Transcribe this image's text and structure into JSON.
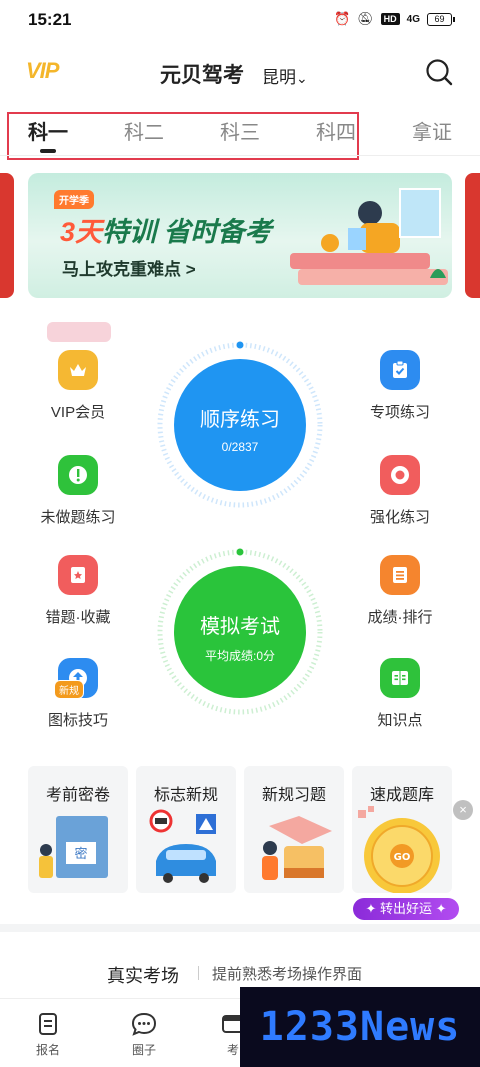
{
  "status_bar": {
    "time": "15:21",
    "hd": "HD",
    "signal": "4G",
    "battery": "69"
  },
  "header": {
    "vip_logo": "VIP",
    "title": "元贝驾考",
    "city": "昆明",
    "city_arrow": "⌄"
  },
  "tabs": [
    {
      "label": "科一",
      "active": true
    },
    {
      "label": "科二",
      "active": false
    },
    {
      "label": "科三",
      "active": false
    },
    {
      "label": "科四",
      "active": false
    },
    {
      "label": "拿证",
      "active": false
    }
  ],
  "banner": {
    "tag": "开学季",
    "headline_accent": "3天",
    "headline_rest": "特训 省时备考",
    "subline": "马上攻克重难点 >"
  },
  "features": {
    "left": [
      {
        "label": "VIP会员",
        "icon": "crown-icon",
        "color": "#f5b833"
      },
      {
        "label": "未做题练习",
        "icon": "exclamation-icon",
        "color": "#2fc23b"
      },
      {
        "label": "错题·收藏",
        "icon": "star-icon",
        "color": "#f15d5d"
      },
      {
        "label": "图标技巧",
        "icon": "upload-icon",
        "color": "#2d8cf0",
        "badge": "新规"
      }
    ],
    "right": [
      {
        "label": "专项练习",
        "icon": "clipboard-icon",
        "color": "#2d8cf0"
      },
      {
        "label": "强化练习",
        "icon": "target-icon",
        "color": "#f15d5d"
      },
      {
        "label": "成绩·排行",
        "icon": "list-icon",
        "color": "#f5852e"
      },
      {
        "label": "知识点",
        "icon": "book-icon",
        "color": "#2fc23b"
      }
    ]
  },
  "practice_circle": {
    "title": "顺序练习",
    "progress": "0/2837",
    "color": "#1f95f2"
  },
  "exam_circle": {
    "title": "模拟考试",
    "score": "平均成绩:0分",
    "color": "#2ac43b"
  },
  "cards": [
    {
      "title": "考前密卷",
      "art_text": "密"
    },
    {
      "title": "标志新规"
    },
    {
      "title": "新规习题"
    },
    {
      "title": "速成题库",
      "art_text": "GO"
    }
  ],
  "lucky_button": "✦ 转出好运 ✦",
  "card_close": "×",
  "exam_section": {
    "title": "真实考场",
    "subtitle": "提前熟悉考场操作界面"
  },
  "bottom_nav": [
    {
      "label": "报名",
      "icon": "document-icon"
    },
    {
      "label": "圈子",
      "icon": "chat-icon"
    },
    {
      "label": "考",
      "icon": "exam-icon"
    }
  ],
  "watermark": "1233News",
  "colors": {
    "highlight": "#e23b4e",
    "accent_vip": "#f4b62b"
  }
}
